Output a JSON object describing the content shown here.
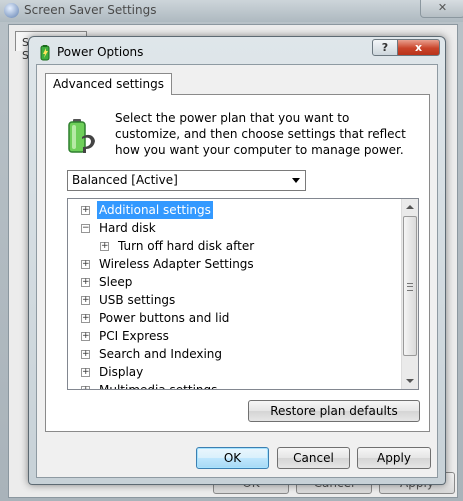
{
  "background_window": {
    "title": "Screen Saver Settings",
    "tab_label": "Screen Saver",
    "ok_label": "OK",
    "cancel_label": "Cancel",
    "apply_label": "Apply"
  },
  "dialog": {
    "title": "Power Options",
    "help_label": "?",
    "close_label": "x",
    "tab_label": "Advanced settings",
    "description": "Select the power plan that you want to customize, and then choose settings that reflect how you want your computer to manage power.",
    "plan_select": {
      "value": "Balanced [Active]"
    },
    "tree_items": [
      {
        "label": "Additional settings",
        "expander": "+",
        "selected": true
      },
      {
        "label": "Hard disk",
        "expander": "−"
      },
      {
        "label": "Turn off hard disk after",
        "expander": "+"
      },
      {
        "label": "Wireless Adapter Settings",
        "expander": "+"
      },
      {
        "label": "Sleep",
        "expander": "+"
      },
      {
        "label": "USB settings",
        "expander": "+"
      },
      {
        "label": "Power buttons and lid",
        "expander": "+"
      },
      {
        "label": "PCI Express",
        "expander": "+"
      },
      {
        "label": "Search and Indexing",
        "expander": "+"
      },
      {
        "label": "Display",
        "expander": "+"
      },
      {
        "label": "Multimedia settings",
        "expander": "+"
      }
    ],
    "restore_label": "Restore plan defaults",
    "ok_label": "OK",
    "cancel_label": "Cancel",
    "apply_label": "Apply"
  },
  "colors": {
    "selection": "#3399ff",
    "close_button": "#c9442a",
    "battery": "#3fae3f"
  }
}
